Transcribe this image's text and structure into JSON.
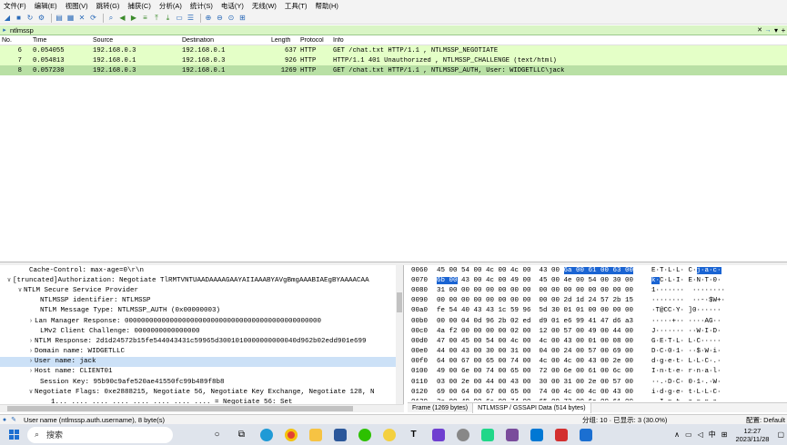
{
  "menu": [
    "文件(F)",
    "编辑(E)",
    "视图(V)",
    "跳转(G)",
    "捕获(C)",
    "分析(A)",
    "统计(S)",
    "电话(Y)",
    "无线(W)",
    "工具(T)",
    "帮助(H)"
  ],
  "toolbar_icons": [
    "shark-fin-start-icon",
    "stop-icon",
    "restart-icon",
    "options-gear-icon",
    "open-file-icon",
    "save-file-icon",
    "close-file-icon",
    "reload-icon",
    "find-icon",
    "back-arrow-icon",
    "forward-arrow-icon",
    "goto-packet-icon",
    "first-packet-icon",
    "last-packet-icon",
    "autoscroll-icon",
    "colorize-icon",
    "zoom-in-icon",
    "zoom-out-icon",
    "zoom-normal-icon",
    "resize-columns-icon"
  ],
  "filter": {
    "value": "ntlmssp"
  },
  "columns": {
    "no": "No.",
    "time": "Time",
    "source": "Source",
    "destination": "Destination",
    "length": "Length",
    "protocol": "Protocol",
    "info": "Info"
  },
  "packets": [
    {
      "no": "6",
      "time": "0.054055",
      "source": "192.168.0.3",
      "destination": "192.168.0.1",
      "length": "637",
      "protocol": "HTTP",
      "info": "GET /chat.txt HTTP/1.1 , NTLMSSP_NEGOTIATE"
    },
    {
      "no": "7",
      "time": "0.054813",
      "source": "192.168.0.1",
      "destination": "192.168.0.3",
      "length": "926",
      "protocol": "HTTP",
      "info": "HTTP/1.1 401 Unauthorized , NTLMSSP_CHALLENGE (text/html)"
    },
    {
      "no": "8",
      "time": "0.057230",
      "source": "192.168.0.3",
      "destination": "192.168.0.1",
      "length": "1269",
      "protocol": "HTTP",
      "info": "GET /chat.txt HTTP/1.1 , NTLMSSP_AUTH, User: WIDGETLLC\\jack"
    }
  ],
  "details": [
    {
      "indent": 4,
      "arrow": "",
      "text": "Cache-Control: max-age=0\\r\\n"
    },
    {
      "indent": 1,
      "arrow": "∨",
      "text": "[truncated]Authorization: Negotiate TlRMTVNTUAADAAAAGAAYAIIAAABYAVgBmgAAABIAEgBYAAAACAA"
    },
    {
      "indent": 3,
      "arrow": "∨",
      "text": "NTLM Secure Service Provider"
    },
    {
      "indent": 6,
      "arrow": "",
      "text": "NTLMSSP identifier: NTLMSSP"
    },
    {
      "indent": 6,
      "arrow": "",
      "text": "NTLM Message Type: NTLMSSP_AUTH (0x00000003)"
    },
    {
      "indent": 5,
      "arrow": "›",
      "text": "Lan Manager Response: 000000000000000000000000000000000000000000000000"
    },
    {
      "indent": 6,
      "arrow": "",
      "text": "LMv2 Client Challenge: 0000000000000000"
    },
    {
      "indent": 5,
      "arrow": "›",
      "text": "NTLM Response: 2d1d24572b15fe544043431c59965d3001010000000000040d962b02edd901e699"
    },
    {
      "indent": 5,
      "arrow": "›",
      "text": "Domain name: WIDGETLLC"
    },
    {
      "indent": 5,
      "arrow": "›",
      "text": "User name: jack"
    },
    {
      "indent": 5,
      "arrow": "›",
      "text": "Host name: CLIENT01"
    },
    {
      "indent": 6,
      "arrow": "",
      "text": "Session Key: 95b90c9afe520ae41550fc99b489f8b8"
    },
    {
      "indent": 5,
      "arrow": "∨",
      "text": "Negotiate Flags: 0xe2888215, Negotiate 56, Negotiate Key Exchange, Negotiate 128, N"
    },
    {
      "indent": 8,
      "arrow": "",
      "text": "1... .... .... .... .... .... .... .... = Negotiate 56: Set"
    }
  ],
  "bytes": [
    {
      "off": "0060",
      "hex_pre": "45 00 54 00 4c 00 4c 00  43 00 ",
      "hex_sel": "6a 00 61 00 63 00",
      "hex_post": "",
      "ascii_pre": "E·T·L·L· C·",
      "ascii_sel": "j·a·c·",
      "ascii_post": ""
    },
    {
      "off": "0070",
      "hex_pre": "",
      "hex_sel": "6b 00",
      "hex_post": " 43 00 4c 00 49 00  45 00 4e 00 54 00 30 00",
      "ascii_pre": "",
      "ascii_sel": "k·",
      "ascii_post": "C·L·I· E·N·T·0·"
    },
    {
      "off": "0080",
      "hex_pre": "31 00 00 00 00 00 00 00  00 00 00 00 00 00 00 00",
      "hex_sel": "",
      "hex_post": "",
      "ascii_pre": "1·······  ········",
      "ascii_sel": "",
      "ascii_post": ""
    },
    {
      "off": "0090",
      "hex_pre": "00 00 00 00 00 00 00 00  00 00 2d 1d 24 57 2b 15",
      "hex_sel": "",
      "hex_post": "",
      "ascii_pre": "········  ··-·$W+·",
      "ascii_sel": "",
      "ascii_post": ""
    },
    {
      "off": "00a0",
      "hex_pre": "fe 54 40 43 43 1c 59 96  5d 30 01 01 00 00 00 00",
      "hex_sel": "",
      "hex_post": "",
      "ascii_pre": "·T@CC·Y· ]0······",
      "ascii_sel": "",
      "ascii_post": ""
    },
    {
      "off": "00b0",
      "hex_pre": "00 00 04 0d 96 2b 02 ed  d9 01 e6 99 41 47 d6 a3",
      "hex_sel": "",
      "hex_post": "",
      "ascii_pre": "·····+·· ····AG··",
      "ascii_sel": "",
      "ascii_post": ""
    },
    {
      "off": "00c0",
      "hex_pre": "4a f2 00 00 00 00 02 00  12 00 57 00 49 00 44 00",
      "hex_sel": "",
      "hex_post": "",
      "ascii_pre": "J······· ··W·I·D·",
      "ascii_sel": "",
      "ascii_post": ""
    },
    {
      "off": "00d0",
      "hex_pre": "47 00 45 00 54 00 4c 00  4c 00 43 00 01 00 08 00",
      "hex_sel": "",
      "hex_post": "",
      "ascii_pre": "G·E·T·L· L·C·····",
      "ascii_sel": "",
      "ascii_post": ""
    },
    {
      "off": "00e0",
      "hex_pre": "44 00 43 00 30 00 31 00  04 00 24 00 57 00 69 00",
      "hex_sel": "",
      "hex_post": "",
      "ascii_pre": "D·C·0·1· ··$·W·i·",
      "ascii_sel": "",
      "ascii_post": ""
    },
    {
      "off": "00f0",
      "hex_pre": "64 00 67 00 65 00 74 00  4c 00 4c 00 43 00 2e 00",
      "hex_sel": "",
      "hex_post": "",
      "ascii_pre": "d·g·e·t· L·L·C·.·",
      "ascii_sel": "",
      "ascii_post": ""
    },
    {
      "off": "0100",
      "hex_pre": "49 00 6e 00 74 00 65 00  72 00 6e 00 61 00 6c 00",
      "hex_sel": "",
      "hex_post": "",
      "ascii_pre": "I·n·t·e· r·n·a·l·",
      "ascii_sel": "",
      "ascii_post": ""
    },
    {
      "off": "0110",
      "hex_pre": "03 00 2e 00 44 00 43 00  30 00 31 00 2e 00 57 00",
      "hex_sel": "",
      "hex_post": "",
      "ascii_pre": "··.·D·C· 0·1·.·W·",
      "ascii_sel": "",
      "ascii_post": ""
    },
    {
      "off": "0120",
      "hex_pre": "69 00 64 00 67 00 65 00  74 00 4c 00 4c 00 43 00",
      "hex_sel": "",
      "hex_post": "",
      "ascii_pre": "i·d·g·e· t·L·L·C·",
      "ascii_sel": "",
      "ascii_post": ""
    },
    {
      "off": "0130",
      "hex_pre": "2e 00 49 00 6e 00 74 00  65 00 72 00 6e 00 61 00",
      "hex_sel": "",
      "hex_post": "",
      "ascii_pre": ".·I·n·t· e·r·n·a·",
      "ascii_sel": "",
      "ascii_post": ""
    }
  ],
  "byte_tabs": [
    "Frame (1269 bytes)",
    "NTLMSSP / GSSAPI Data (514 bytes)"
  ],
  "status": {
    "field": "User name (ntlmssp.auth.username), 8 byte(s)",
    "packets": "分组: 10 · 已显示: 3 (30.0%)",
    "profile": "配置: Default"
  },
  "taskbar": {
    "search_placeholder": "搜索",
    "apps": [
      "task-view-icon",
      "file-explorer-icon",
      "edge-icon",
      "chrome-icon",
      "folder-icon",
      "word-icon",
      "wechat-icon",
      "app-yellow-icon",
      "typora-icon",
      "obsidian-icon",
      "wireshark-tray-icon",
      "pycharm-icon",
      "winrar-icon",
      "vscode-icon",
      "firefox-icon",
      "wireshark-icon"
    ],
    "time": "12:27",
    "date": "2023/11/28",
    "ime": "中"
  },
  "colors": {
    "http_row": "#e4ffc7",
    "selected_row": "#b9e0a5",
    "filter_ok": "#d9f5c5",
    "byte_highlight": "#1a64d3",
    "detail_highlight": "#cce1f7"
  }
}
